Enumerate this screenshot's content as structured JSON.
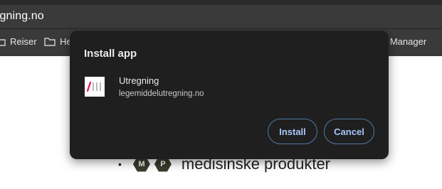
{
  "browser": {
    "address": "tgning.no",
    "bookmarks": [
      {
        "label": "Reiser",
        "icon": "folder-icon"
      },
      {
        "label": "He",
        "icon": "folder-icon"
      },
      {
        "label": "d Manager",
        "icon": ""
      }
    ]
  },
  "page": {
    "badges": [
      "M",
      "P"
    ],
    "heading": "medisinske produkter"
  },
  "dialog": {
    "title": "Install app",
    "app": {
      "name": "Utregning",
      "domain": "legemiddelutregning.no",
      "icon": "utregning-app-icon"
    },
    "buttons": {
      "install": "Install",
      "cancel": "Cancel"
    }
  },
  "colors": {
    "dialog_bg": "#1f1f1f",
    "button_text": "#a8c7fa",
    "button_border": "#4e7aa6",
    "icon_accent": "#e0245e"
  }
}
